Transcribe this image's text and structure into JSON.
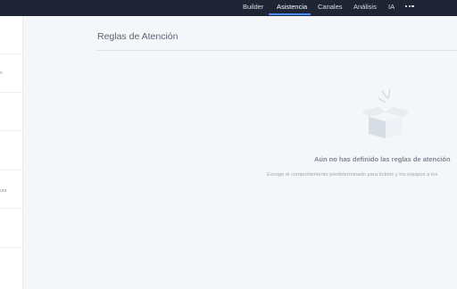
{
  "topnav": {
    "items": [
      {
        "label": "Builder",
        "active": false
      },
      {
        "label": "Asistencia",
        "active": true
      },
      {
        "label": "Canales",
        "active": false
      },
      {
        "label": "Análisis",
        "active": false
      },
      {
        "label": "IA",
        "active": false
      }
    ],
    "more_icon": "more-horizontal-icon",
    "accent_color": "#4b8cff",
    "bar_color": "#1f2535"
  },
  "sidebar": {
    "items": [
      {
        "label": ""
      },
      {
        "label": "o"
      },
      {
        "label": ""
      },
      {
        "label": ""
      },
      {
        "label": "ura"
      },
      {
        "label": ""
      }
    ]
  },
  "main": {
    "title": "Reglas de Atención",
    "empty_state": {
      "icon": "empty-box-icon",
      "title": "Aún no has definido las reglas de atención",
      "description": "Escoge el comportamiento predeterminado para tickets y los equipos a los"
    }
  }
}
